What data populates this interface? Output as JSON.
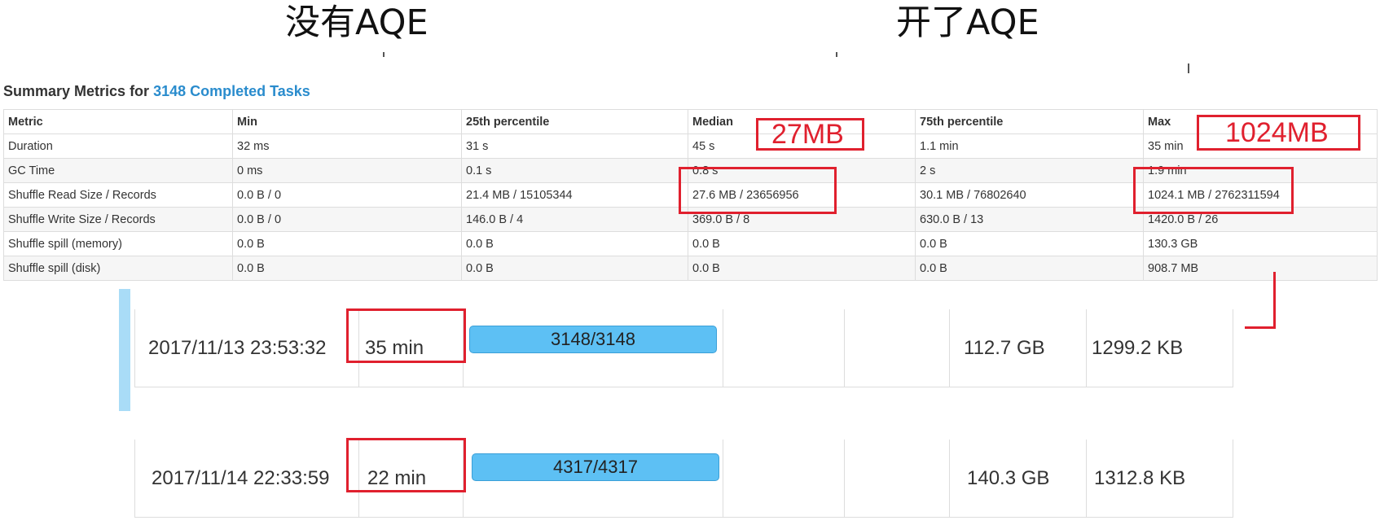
{
  "headings": {
    "left": "没有AQE",
    "right": "开了AQE"
  },
  "summary": {
    "title_prefix": "Summary Metrics for ",
    "title_link": "3148 Completed Tasks",
    "columns": [
      "Metric",
      "Min",
      "25th percentile",
      "Median",
      "75th percentile",
      "Max"
    ],
    "rows": [
      [
        "Duration",
        "32 ms",
        "31 s",
        "45 s",
        "1.1 min",
        "35 min"
      ],
      [
        "GC Time",
        "0 ms",
        "0.1 s",
        "0.8 s",
        "2 s",
        "1.9 min"
      ],
      [
        "Shuffle Read Size / Records",
        "0.0 B / 0",
        "21.4 MB / 15105344",
        "27.6 MB / 23656956",
        "30.1 MB / 76802640",
        "1024.1 MB / 2762311594"
      ],
      [
        "Shuffle Write Size / Records",
        "0.0 B / 0",
        "146.0 B / 4",
        "369.0 B / 8",
        "630.0 B / 13",
        "1420.0 B / 26"
      ],
      [
        "Shuffle spill (memory)",
        "0.0 B",
        "0.0 B",
        "0.0 B",
        "0.0 B",
        "130.3 GB"
      ],
      [
        "Shuffle spill (disk)",
        "0.0 B",
        "0.0 B",
        "0.0 B",
        "0.0 B",
        "908.7 MB"
      ]
    ]
  },
  "annotations": {
    "median_label": "27MB",
    "max_label": "1024MB",
    "highlight_color": "#e0202e"
  },
  "stages": [
    {
      "submitted": "2017/11/13 23:53:32",
      "duration": "35 min",
      "progress": "3148/3148",
      "progress_fraction": 1.0,
      "input": "",
      "output": "",
      "shuffle_read": "112.7 GB",
      "shuffle_write": "1299.2 KB"
    },
    {
      "submitted": "2017/11/14 22:33:59",
      "duration": "22 min",
      "progress": "4317/4317",
      "progress_fraction": 1.0,
      "input": "",
      "output": "",
      "shuffle_read": "140.3 GB",
      "shuffle_write": "1312.8 KB"
    }
  ],
  "colors": {
    "link": "#2a8ccd",
    "progress_fill": "#5dc0f4"
  }
}
